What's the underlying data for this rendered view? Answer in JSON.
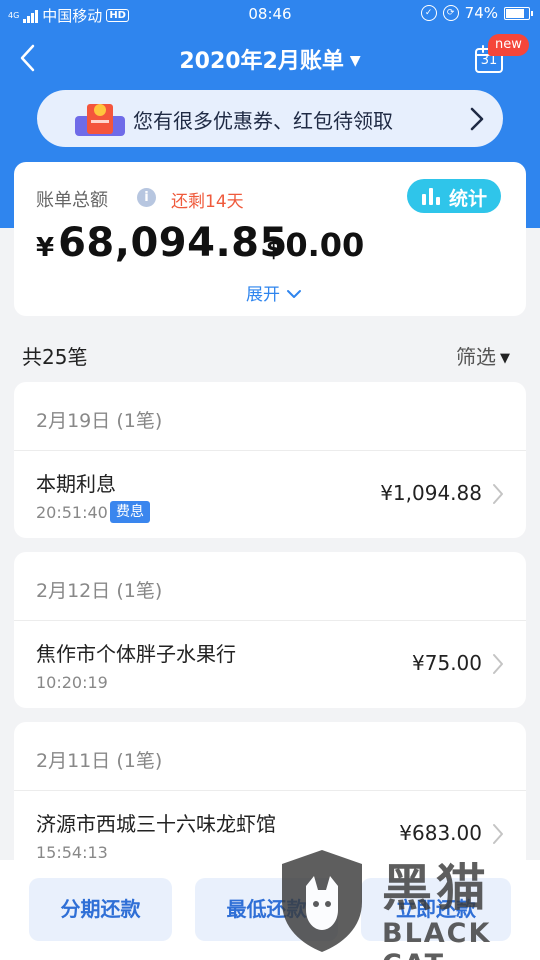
{
  "status_bar": {
    "network": "4G",
    "carrier": "中国移动",
    "hd": "HD",
    "time": "08:46",
    "battery": "74%",
    "battery_level": 0.74
  },
  "header": {
    "title": "2020年2月账单",
    "calendar_day": "31",
    "new_badge": "new"
  },
  "promo": {
    "text": "您有很多优惠券、红包待领取"
  },
  "summary": {
    "label": "账单总额",
    "info_icon": "i",
    "remaining": "还剩14天",
    "stats_label": "统计",
    "cny_symbol": "¥",
    "cny_amount": "68,094.85",
    "usd_symbol": "$",
    "usd_amount": "0.00",
    "expand_label": "展开"
  },
  "list": {
    "count_label": "共25笔",
    "filter_label": "筛选",
    "groups": [
      {
        "date": "2月19日",
        "count": "(1笔)",
        "merchant": "本期利息",
        "time": "20:51:40",
        "tag": "费息",
        "amount": "¥1,094.88"
      },
      {
        "date": "2月12日",
        "count": "(1笔)",
        "merchant": "焦作市个体胖子水果行",
        "time": "10:20:19",
        "amount": "¥75.00"
      },
      {
        "date": "2月11日",
        "count": "(1笔)",
        "merchant": "济源市西城三十六味龙虾馆",
        "time": "15:54:13",
        "amount": "¥683.00"
      }
    ]
  },
  "bottom_bar": {
    "installment": "分期还款",
    "minimum": "最低还款",
    "repay_now": "立即还款"
  },
  "watermark": {
    "cn": "黑猫",
    "en": "BLACK CAT"
  },
  "colors": {
    "primary": "#2f85ee",
    "accent_orange": "#ef5a3c",
    "stats_cyan": "#2fc5ea",
    "badge_red": "#f5463a"
  }
}
